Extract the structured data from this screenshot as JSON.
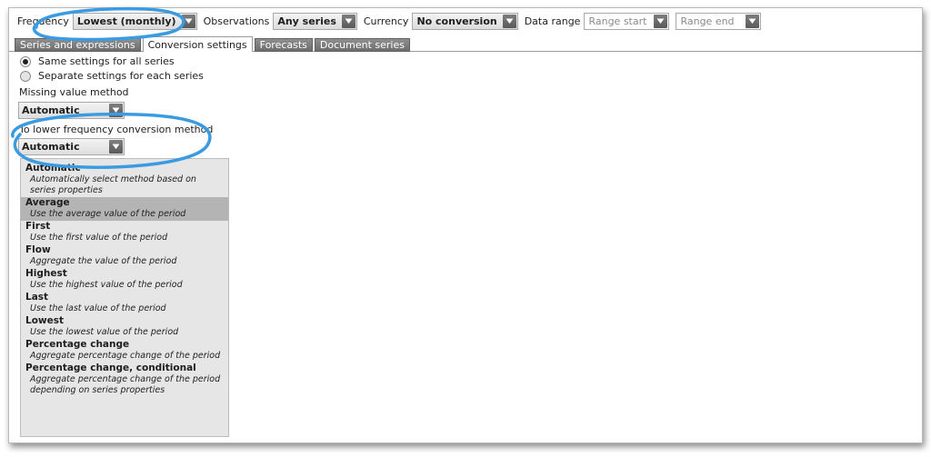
{
  "toolbar": {
    "frequency_label": "Frequency",
    "frequency_value": "Lowest (monthly)",
    "observations_label": "Observations",
    "observations_value": "Any series",
    "currency_label": "Currency",
    "currency_value": "No conversion",
    "date_range_label": "Data range",
    "range_start_placeholder": "Range start",
    "range_end_placeholder": "Range end"
  },
  "tabs": [
    {
      "label": "Series and expressions",
      "active": false
    },
    {
      "label": "Conversion settings",
      "active": true
    },
    {
      "label": "Forecasts",
      "active": false
    },
    {
      "label": "Document series",
      "active": false
    }
  ],
  "settings": {
    "radio_same": "Same settings for all series",
    "radio_separate": "Separate settings for each series",
    "missing_label": "Missing value method",
    "missing_value": "Automatic",
    "lower_freq_label": "To lower frequency conversion method",
    "lower_freq_value": "Automatic"
  },
  "options": [
    {
      "title": "Automatic",
      "desc": "Automatically select method based on series properties"
    },
    {
      "title": "Average",
      "desc": "Use the average value of the period"
    },
    {
      "title": "First",
      "desc": "Use the first value of the period"
    },
    {
      "title": "Flow",
      "desc": "Aggregate the value of the period"
    },
    {
      "title": "Highest",
      "desc": "Use the highest value of the period"
    },
    {
      "title": "Last",
      "desc": "Use the last value of the period"
    },
    {
      "title": "Lowest",
      "desc": "Use the lowest value of the period"
    },
    {
      "title": "Percentage change",
      "desc": "Aggregate percentage change of the period"
    },
    {
      "title": "Percentage change, conditional",
      "desc": "Aggregate percentage change of the period depending on series properties"
    }
  ],
  "colors": {
    "annotation": "#3a9be0",
    "selected_option": "#b4b4b4",
    "tab_inactive": "#7d7d7d"
  }
}
